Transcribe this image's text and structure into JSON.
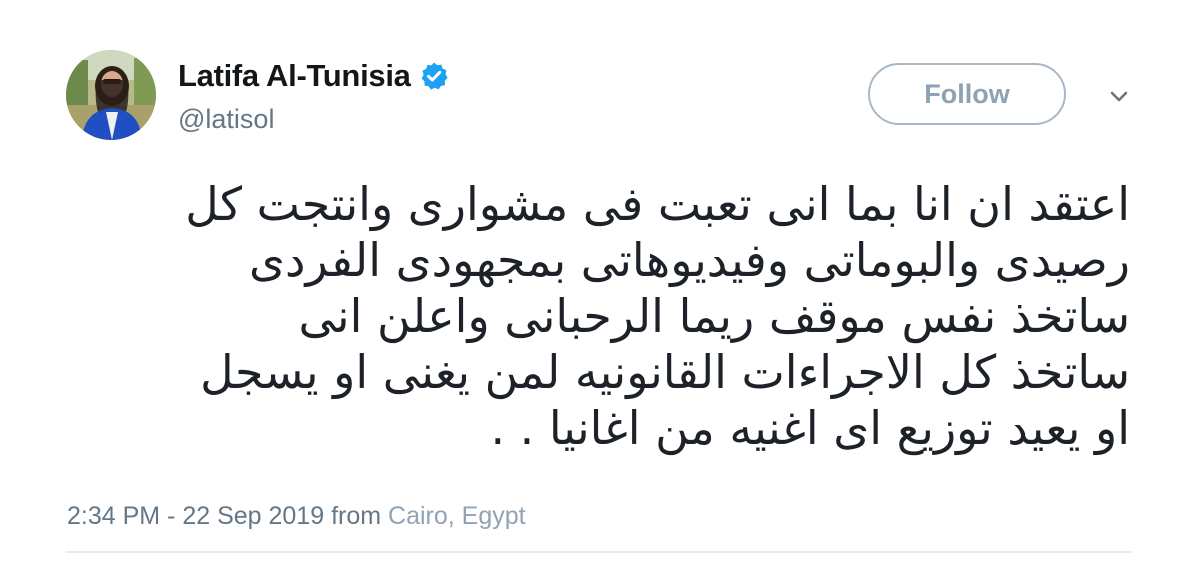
{
  "author": {
    "name": "Latifa Al-Tunisia",
    "handle": "@latisol",
    "verified": true,
    "verified_color": "#1da1f2"
  },
  "actions": {
    "follow_label": "Follow",
    "menu_icon": "chevron-down-icon"
  },
  "tweet": {
    "lines": [
      "اعتقد ان انا بما انى تعبت فى مشوارى وانتجت كل",
      "رصيدى والبوماتى وفيديوهاتى بمجهودى الفردى",
      "ساتخذ نفس موقف ريما الرحبانى واعلن انى",
      "ساتخذ كل الاجراءات القانونيه لمن يغنى او يسجل",
      "او يعيد توزيع اى اغنيه من اغانيا . ."
    ]
  },
  "meta": {
    "timestamp": "2:34 PM - 22 Sep 2019 from ",
    "location": "Cairo, Egypt"
  },
  "colors": {
    "text": "#14171a",
    "secondary": "#657786",
    "follow_border": "#a9b8c4",
    "follow_text": "#8da2b3"
  }
}
